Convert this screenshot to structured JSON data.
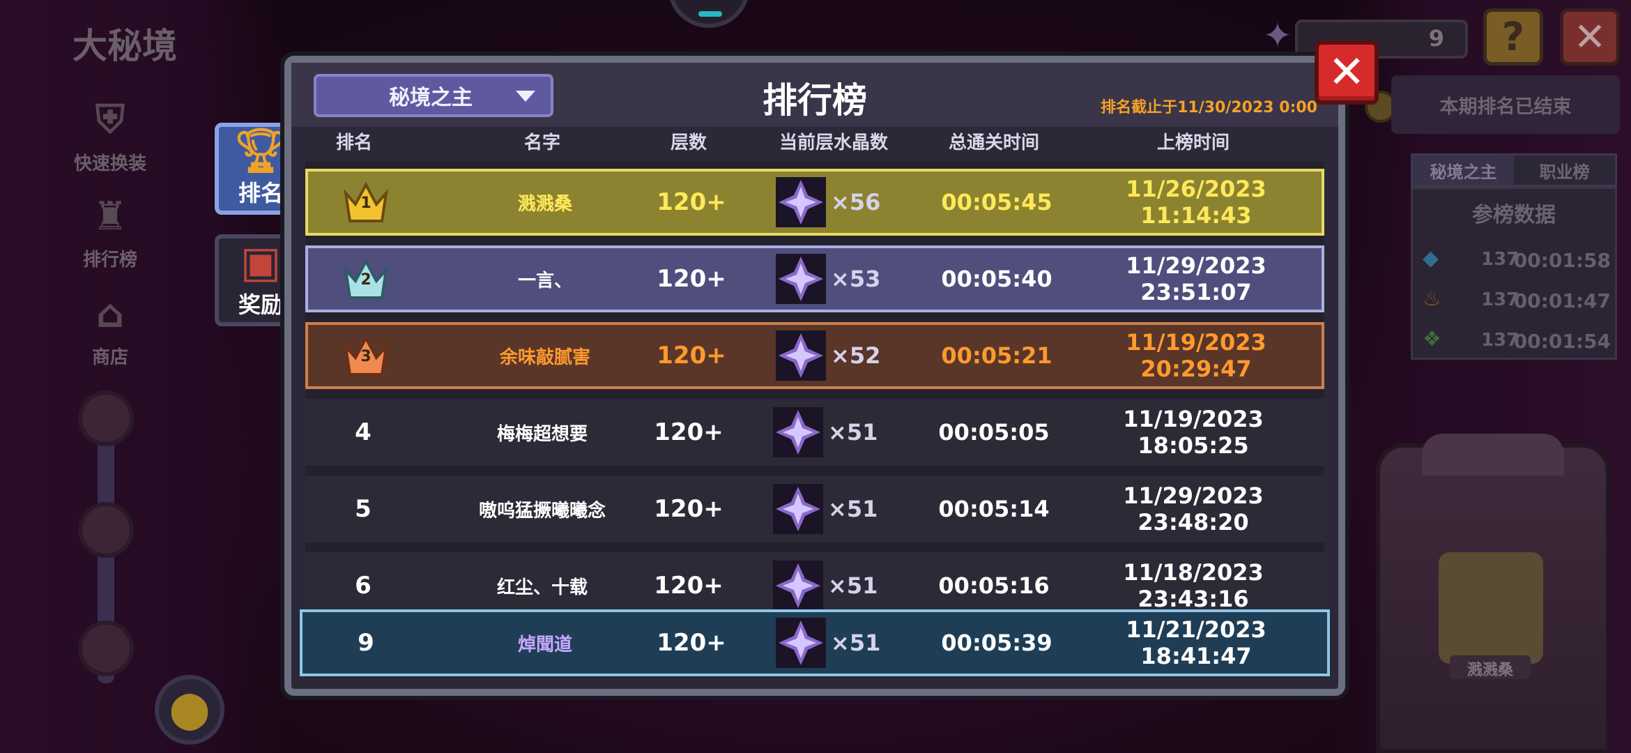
{
  "scene": {
    "title": "大秘境",
    "side_buttons": [
      {
        "label": "快速换装",
        "icon": "armor-icon"
      },
      {
        "label": "排行榜",
        "icon": "trophy-icon"
      },
      {
        "label": "商店",
        "icon": "shop-icon"
      }
    ],
    "hud_count": "9",
    "hud_help": "?",
    "hud_close": "✕",
    "period_status": "本期排名已结束",
    "side_tabs": [
      "秘境之主",
      "职业榜"
    ],
    "side_panel_title": "参榜数据",
    "side_rows": [
      {
        "gem": "blue-crystal-icon",
        "count": "137",
        "time": "00:01:58"
      },
      {
        "gem": "orange-flame-icon",
        "count": "137",
        "time": "00:01:47"
      },
      {
        "gem": "green-leaf-icon",
        "count": "137",
        "time": "00:01:54"
      }
    ],
    "statue_name": "溅溅桑"
  },
  "panel": {
    "dropdown_label": "秘境之主",
    "title": "排行榜",
    "deadline": "排名截止于11/30/2023 0:00",
    "close": "✕",
    "tabs": [
      {
        "label": "排名",
        "icon": "trophy-icon"
      },
      {
        "label": "奖励",
        "icon": "treasure-chest-icon"
      }
    ],
    "columns": [
      "排名",
      "名字",
      "层数",
      "当前层水晶数",
      "总通关时间",
      "上榜时间"
    ],
    "rows": [
      {
        "rank": "1",
        "name": "溅溅桑",
        "floor": "120+",
        "crystals": "×56",
        "total": "00:05:45",
        "date": "11/26/2023 11:14:43"
      },
      {
        "rank": "2",
        "name": "一言、",
        "floor": "120+",
        "crystals": "×53",
        "total": "00:05:40",
        "date": "11/29/2023 23:51:07"
      },
      {
        "rank": "3",
        "name": "余味敲腻害",
        "floor": "120+",
        "crystals": "×52",
        "total": "00:05:21",
        "date": "11/19/2023 20:29:47"
      },
      {
        "rank": "4",
        "name": "梅梅超想要",
        "floor": "120+",
        "crystals": "×51",
        "total": "00:05:05",
        "date": "11/19/2023 18:05:25"
      },
      {
        "rank": "5",
        "name": "嗷呜猛撅曦曦念",
        "floor": "120+",
        "crystals": "×51",
        "total": "00:05:14",
        "date": "11/29/2023 23:48:20"
      },
      {
        "rank": "6",
        "name": "红尘、十载",
        "floor": "120+",
        "crystals": "×51",
        "total": "00:05:16",
        "date": "11/18/2023 23:43:16"
      }
    ],
    "self_row": {
      "rank": "9",
      "name": "焯聞道",
      "floor": "120+",
      "crystals": "×51",
      "total": "00:05:39",
      "date": "11/21/2023 18:41:47"
    }
  },
  "colors": {
    "gold": "#ffe95a",
    "silver_row": "#4f4e7d",
    "bronze": "#ff9a2e",
    "self_name": "#c7a7ff",
    "close_red": "#d72b2b",
    "deadline": "#f5a125"
  }
}
